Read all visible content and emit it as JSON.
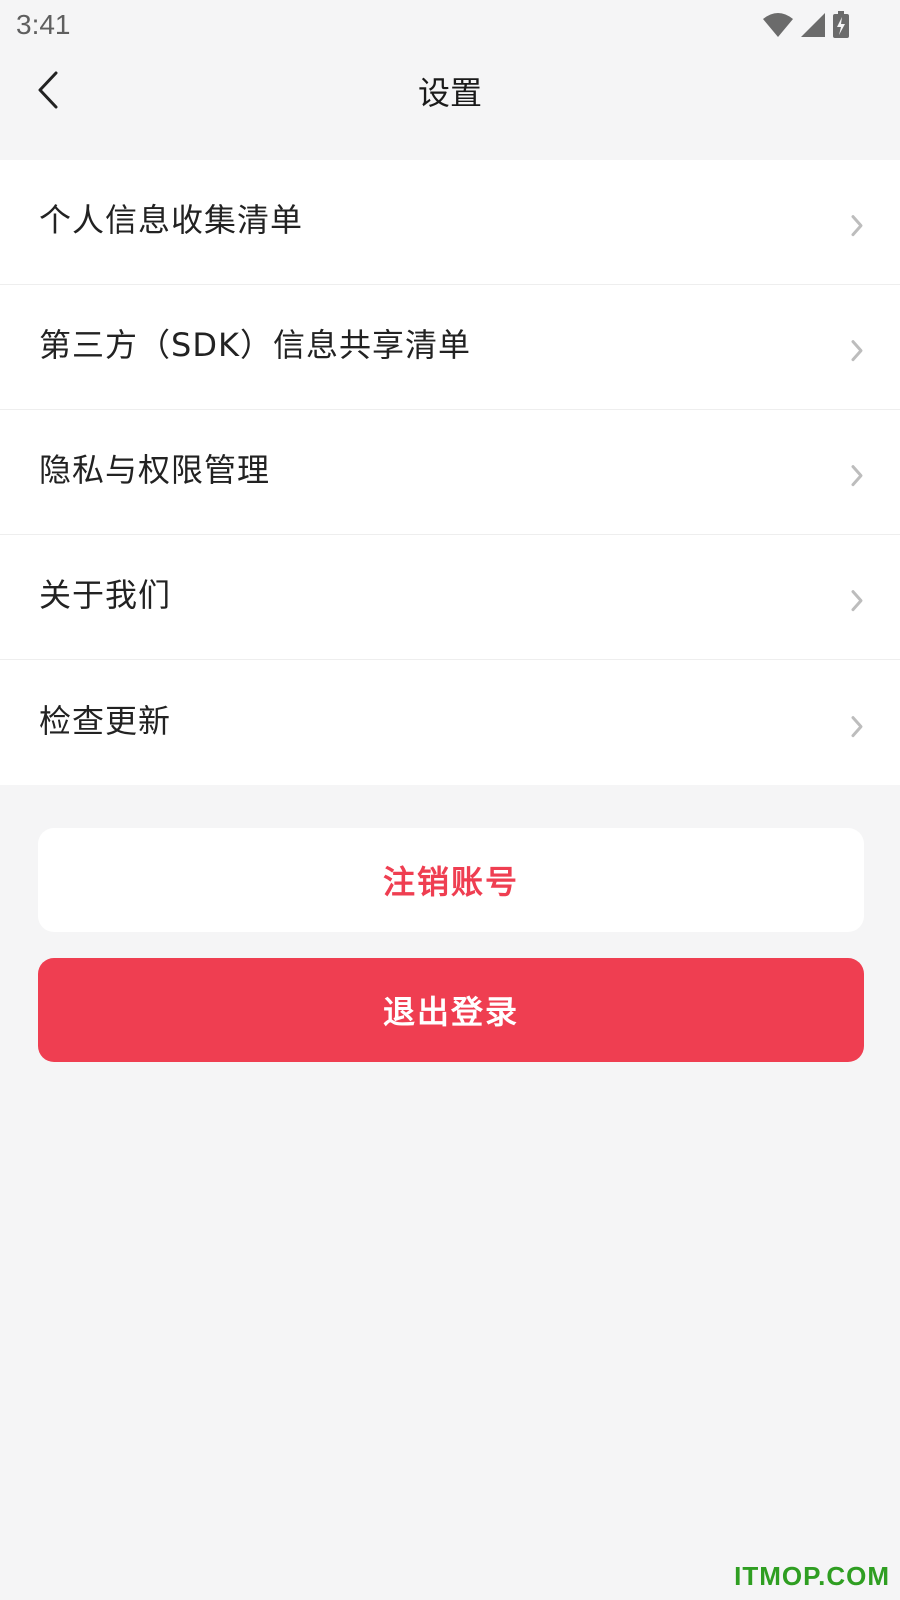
{
  "status_bar": {
    "time": "3:41",
    "icons": [
      "wifi-icon",
      "cellular-signal-icon",
      "battery-charging-icon"
    ]
  },
  "nav": {
    "back_icon": "chevron-left-icon",
    "title": "设置"
  },
  "menu": {
    "items": [
      {
        "label": "个人信息收集清单",
        "icon": "chevron-right-icon"
      },
      {
        "label": "第三方（SDK）信息共享清单",
        "icon": "chevron-right-icon"
      },
      {
        "label": "隐私与权限管理",
        "icon": "chevron-right-icon"
      },
      {
        "label": "关于我们",
        "icon": "chevron-right-icon"
      },
      {
        "label": "检查更新",
        "icon": "chevron-right-icon"
      }
    ]
  },
  "actions": {
    "deactivate_label": "注销账号",
    "logout_label": "退出登录"
  },
  "watermark": "ITMOP.COM",
  "colors": {
    "accent": "#ef3e51",
    "background": "#f5f5f6",
    "card": "#ffffff",
    "chevron": "#bdbdbd",
    "watermark": "#2f9e22"
  }
}
